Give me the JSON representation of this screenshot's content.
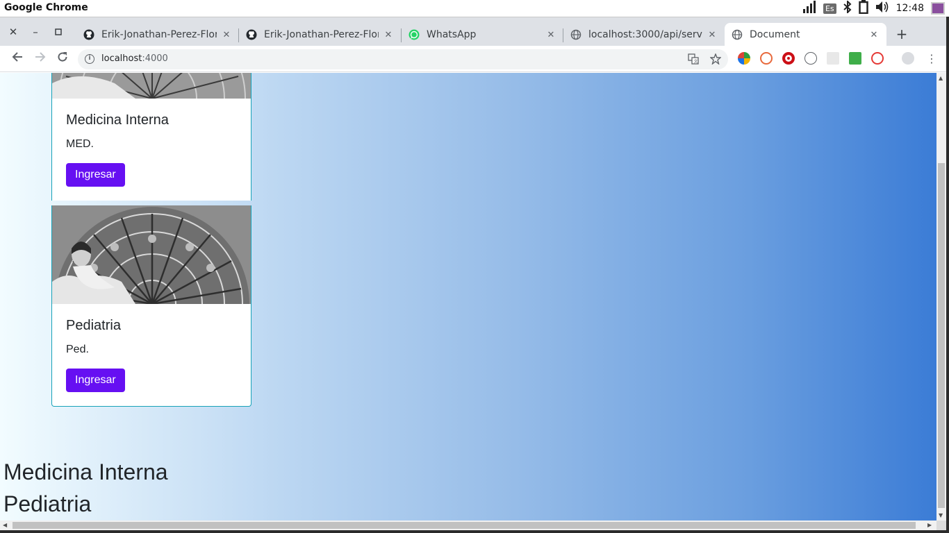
{
  "os": {
    "app_name": "Google Chrome",
    "keyboard_layout": "Es",
    "clock": "12:48"
  },
  "tabs": [
    {
      "title": "Erik-Jonathan-Perez-Flor",
      "icon": "github-icon",
      "active": false
    },
    {
      "title": "Erik-Jonathan-Perez-Flor",
      "icon": "github-icon",
      "active": false
    },
    {
      "title": "WhatsApp",
      "icon": "whatsapp-icon",
      "active": false
    },
    {
      "title": "localhost:3000/api/servic",
      "icon": "globe-icon",
      "active": false
    },
    {
      "title": "Document",
      "icon": "globe-icon",
      "active": true
    }
  ],
  "address_bar": {
    "host": "localhost",
    "port": ":4000"
  },
  "cards": [
    {
      "title": "Medicina Interna",
      "text": "MED.",
      "button": "Ingresar"
    },
    {
      "title": "Pediatria",
      "text": "Ped.",
      "button": "Ingresar"
    }
  ],
  "list": [
    "Medicina Interna",
    "Pediatria"
  ],
  "colors": {
    "button": "#6610f2",
    "card_border": "#17a2b8",
    "gradient_start": "#f2fcff",
    "gradient_end": "#3b7cd6"
  }
}
